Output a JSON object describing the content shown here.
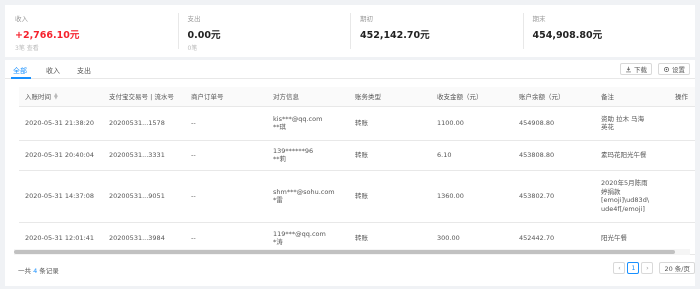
{
  "summary": [
    {
      "label": "收入",
      "value": "+2,766.10元",
      "sub": "3笔 查看",
      "highlight": true
    },
    {
      "label": "支出",
      "value": "0.00元",
      "sub": "0笔"
    },
    {
      "label": "期初",
      "value": "452,142.70元"
    },
    {
      "label": "期末",
      "value": "454,908.80元"
    }
  ],
  "tabs": [
    {
      "label": "全部",
      "active": true
    },
    {
      "label": "收入"
    },
    {
      "label": "支出"
    }
  ],
  "toolbar": {
    "download_label": "下载",
    "settings_label": "设置"
  },
  "table": {
    "headers": [
      "入账时间",
      "支付宝交易号 | 流水号",
      "商户订单号",
      "对方信息",
      "账务类型",
      "收支金额（元）",
      "账户余额（元）",
      "备注",
      "操作"
    ],
    "rows": [
      {
        "time": "2020-05-31 21:38:20",
        "trade_no": "20200531...1578",
        "order_no": "--",
        "counterparty": "kis***@qq.com\n**琪",
        "type": "转账",
        "amount": "1100.00",
        "balance": "454908.80",
        "memo": "资助 拉木 马海\n英花"
      },
      {
        "time": "2020-05-31 20:40:04",
        "trade_no": "20200531...3331",
        "order_no": "--",
        "counterparty": "139******96\n**莉",
        "type": "转账",
        "amount": "6.10",
        "balance": "453808.80",
        "memo": "素玛花阳光午餐"
      },
      {
        "time": "2020-05-31 14:37:08",
        "trade_no": "20200531...9051",
        "order_no": "--",
        "counterparty": "shm***@sohu.com\n*雷",
        "type": "转账",
        "amount": "1360.00",
        "balance": "453802.70",
        "memo": "2020年5月陈雨\n婷捐款\n[emoji]\\ud83d\\\nude4f[/emoji]"
      },
      {
        "time": "2020-05-31 12:01:41",
        "trade_no": "20200531...3984",
        "order_no": "--",
        "counterparty": "119***@qq.com\n*涛",
        "type": "转账",
        "amount": "300.00",
        "balance": "452442.70",
        "memo": "阳光午餐"
      }
    ]
  },
  "footer": {
    "count_prefix": "一共 ",
    "count": "4",
    "count_suffix": " 条记录"
  },
  "pagination": {
    "prev": "‹",
    "current": "1",
    "next": "›",
    "page_size": "20 条/页"
  },
  "colors": {
    "accent": "#1890ff",
    "income": "#f5222d"
  }
}
